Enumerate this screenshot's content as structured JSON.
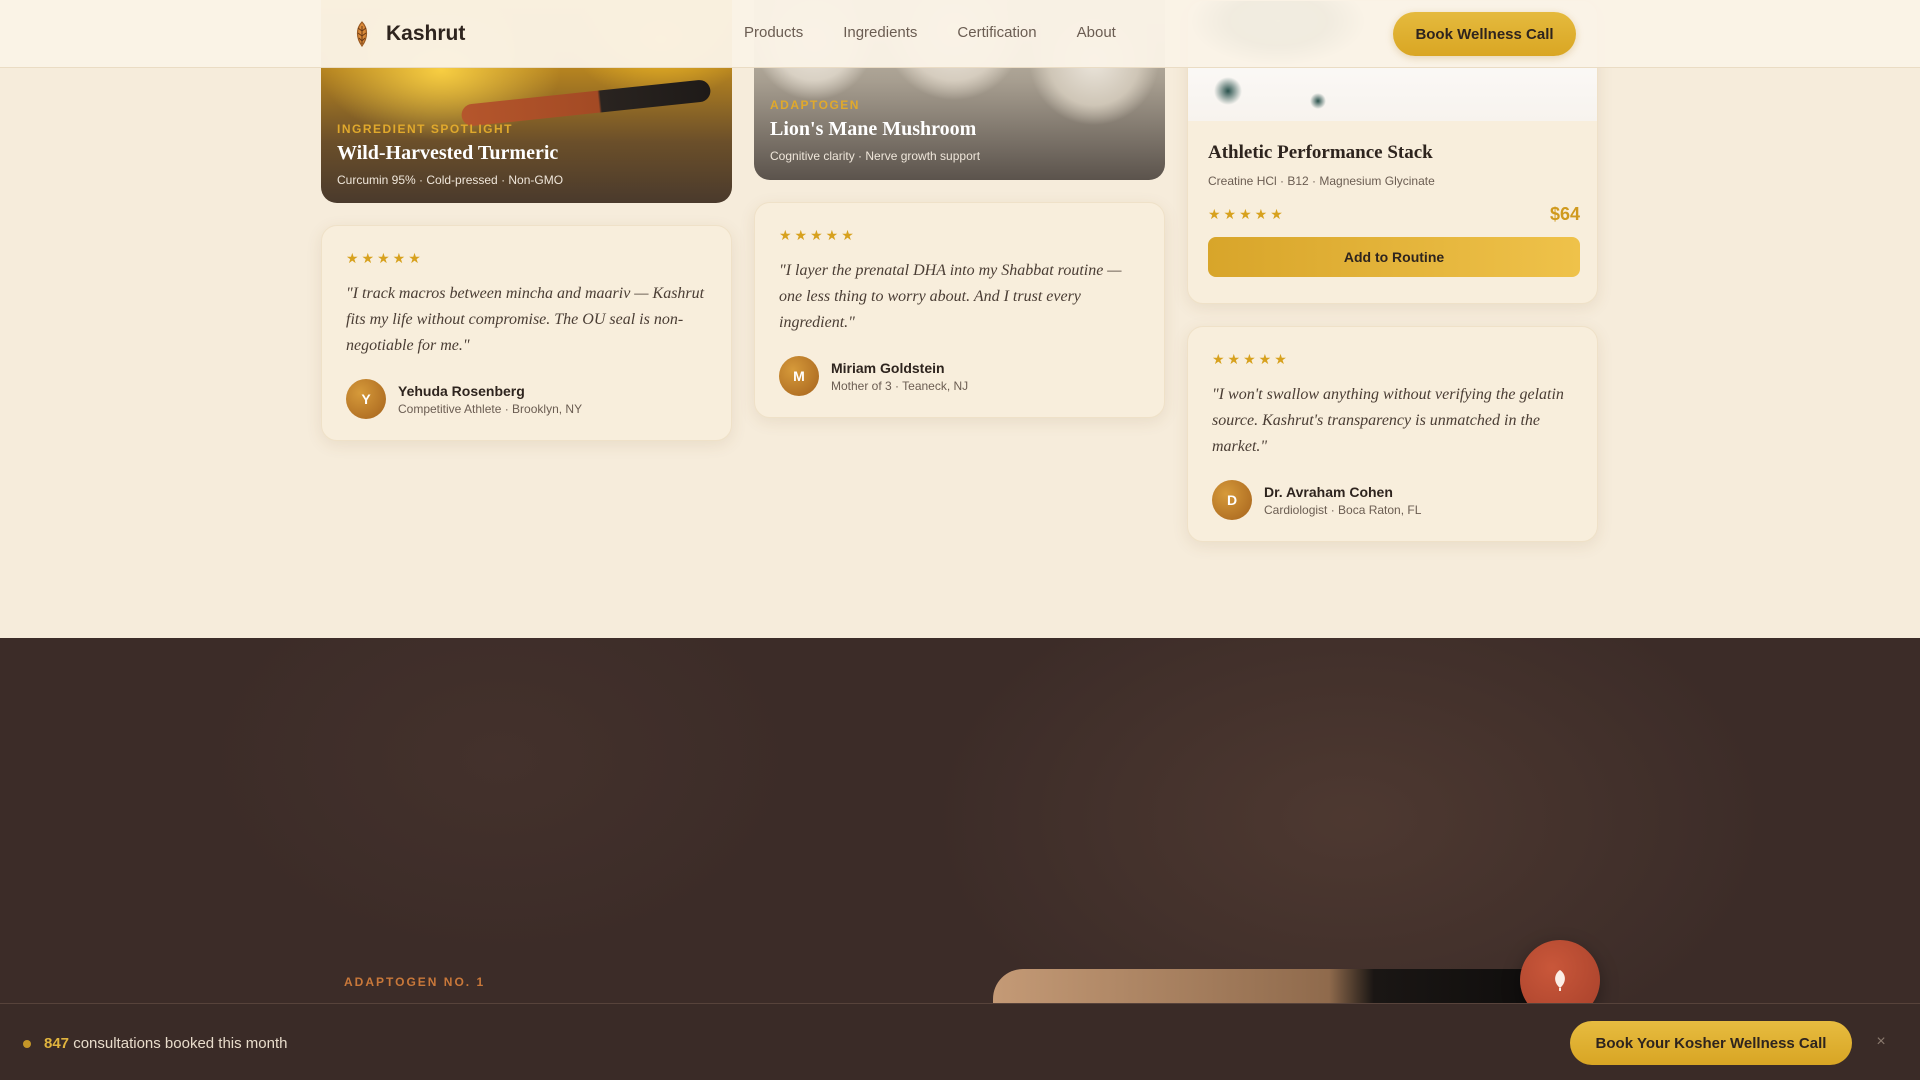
{
  "nav": {
    "brand": "Kashrut",
    "links": [
      "Products",
      "Ingredients",
      "Certification",
      "About"
    ],
    "cta": "Book Wellness Call"
  },
  "spotlights": [
    {
      "kicker": "INGREDIENT SPOTLIGHT",
      "title": "Wild-Harvested Turmeric",
      "details": "Curcumin 95% · Cold-pressed · Non-GMO"
    },
    {
      "kicker": "ADAPTOGEN",
      "title": "Lion's Mane Mushroom",
      "details": "Cognitive clarity · Nerve growth support"
    }
  ],
  "product": {
    "title": "Athletic Performance Stack",
    "tags": "Creatine HCl · B12 · Magnesium Glycinate",
    "stars": "★★★★★",
    "price": "$64",
    "cta": "Add to Routine"
  },
  "testimonials": [
    {
      "stars": "★★★★★",
      "quote": "\"I track macros between mincha and maariv — Kashrut fits my life without compromise. The OU seal is non-negotiable for me.\"",
      "initial": "Y",
      "name": "Yehuda Rosenberg",
      "meta": "Competitive Athlete · Brooklyn, NY"
    },
    {
      "stars": "★★★★★",
      "quote": "\"I layer the prenatal DHA into my Shabbat routine — one less thing to worry about. And I trust every ingredient.\"",
      "initial": "M",
      "name": "Miriam Goldstein",
      "meta": "Mother of 3 · Teaneck, NJ"
    },
    {
      "stars": "★★★★★",
      "quote": "\"I won't swallow anything without verifying the gelatin source. Kashrut's transparency is unmatched in the market.\"",
      "initial": "D",
      "name": "Dr. Avraham Cohen",
      "meta": "Cardiologist · Boca Raton, FL"
    }
  ],
  "feature": {
    "kicker": "ADAPTOGEN NO. 1"
  },
  "bottom_bar": {
    "count": "847",
    "text": " consultations booked this month",
    "cta": "Book Your Kosher Wellness Call",
    "close": "×"
  },
  "colors": {
    "background": "#f6ecdb",
    "accent_gold": "#d9a623",
    "dark_section": "#3c2c28",
    "terracotta": "#a6402a"
  },
  "icons": [
    "kashrut-logo-icon",
    "leaf-icon",
    "close-icon"
  ]
}
